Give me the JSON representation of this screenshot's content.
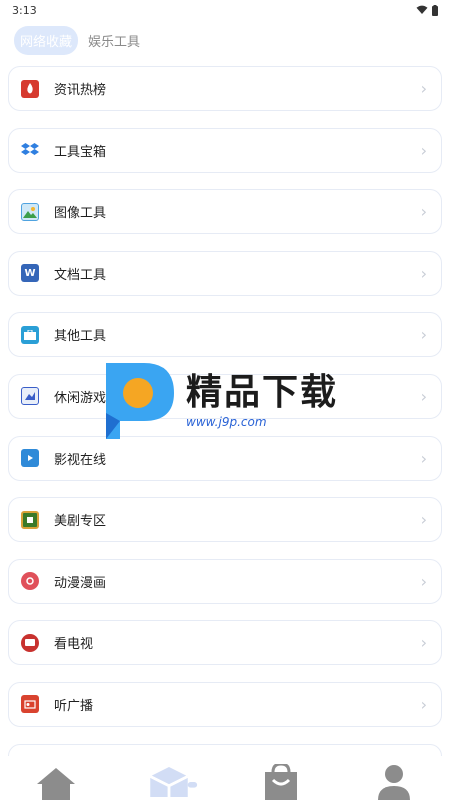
{
  "status": {
    "time": "3:13"
  },
  "tabs": [
    {
      "label": "网络收藏",
      "active": true
    },
    {
      "label": "娱乐工具",
      "active": false
    }
  ],
  "items": [
    {
      "label": "资讯热榜",
      "icon": "fire-news-icon",
      "color": "#d63a2f"
    },
    {
      "label": "工具宝箱",
      "icon": "dropbox-icon",
      "color": "#2f7fe0"
    },
    {
      "label": "图像工具",
      "icon": "image-icon",
      "color": "#4fa3e0"
    },
    {
      "label": "文档工具",
      "icon": "word-doc-icon",
      "color": "#3566b8"
    },
    {
      "label": "其他工具",
      "icon": "toolbox-icon",
      "color": "#2a9fd6"
    },
    {
      "label": "休闲游戏",
      "icon": "game-icon",
      "color": "#3a5ec8"
    },
    {
      "label": "影视在线",
      "icon": "film-icon",
      "color": "#2f8ad8"
    },
    {
      "label": "美剧专区",
      "icon": "tv-series-icon",
      "color": "#3a7a2a"
    },
    {
      "label": "动漫漫画",
      "icon": "anime-icon",
      "color": "#e0505a"
    },
    {
      "label": "看电视",
      "icon": "tv-icon",
      "color": "#c8322f"
    },
    {
      "label": "听广播",
      "icon": "radio-icon",
      "color": "#d9432f"
    },
    {
      "label": "",
      "icon": "more-icon",
      "color": "#cccccc"
    }
  ],
  "watermark": {
    "title": "精品下载",
    "url": "www.j9p.com"
  },
  "nav": [
    {
      "name": "home-icon"
    },
    {
      "name": "box-icon"
    },
    {
      "name": "bag-icon"
    },
    {
      "name": "user-icon"
    }
  ]
}
